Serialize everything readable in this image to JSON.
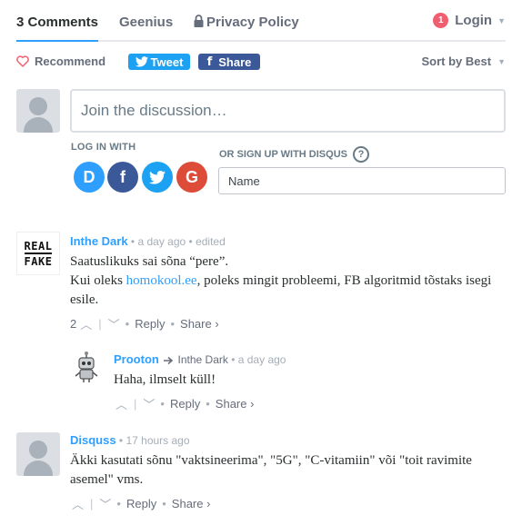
{
  "nav": {
    "comments_tab": "3 Comments",
    "community_tab": "Geenius",
    "privacy_tab": "Privacy Policy",
    "notification_count": "1",
    "login_label": "Login"
  },
  "actions": {
    "recommend_label": "Recommend",
    "tweet_label": "Tweet",
    "share_label": "Share",
    "sort_label": "Sort by Best"
  },
  "compose": {
    "placeholder": "Join the discussion…",
    "login_with": "LOG IN WITH",
    "signup_label": "OR SIGN UP WITH DISQUS",
    "help": "?",
    "name_placeholder": "Name",
    "social": [
      "D",
      "f",
      "t",
      "G"
    ]
  },
  "comments": [
    {
      "author": "Inthe Dark",
      "time": "a day ago",
      "edited": "edited",
      "avatar_lines": [
        "REAL",
        "FAKE"
      ],
      "text_line1": "Saatuslikuks sai sõna “pere”.",
      "text_line2_pre": "Kui oleks ",
      "text_link": "homokool.ee",
      "text_line2_post": ", poleks mingit probleemi, FB algoritmid tõstaks isegi esile.",
      "votes": "2",
      "reply_label": "Reply",
      "share_label": "Share ›"
    },
    {
      "author": "Prooton",
      "reply_to": "Inthe Dark",
      "time": "a day ago",
      "text": "Haha, ilmselt küll!",
      "reply_label": "Reply",
      "share_label": "Share ›"
    },
    {
      "author": "Disquss",
      "time": "17 hours ago",
      "text": "Äkki kasutati sõnu \"vaktsineerima\", \"5G\", \"C-vitamiin\" või \"toit ravimite asemel\" vms.",
      "reply_label": "Reply",
      "share_label": "Share ›"
    }
  ],
  "colors": {
    "accent": "#2e9fff",
    "tweet": "#1da1f2",
    "facebook": "#3b5998",
    "notification": "#f05f70",
    "disqus": "#2e9fff",
    "twitter_social": "#1da1f2",
    "google": "#dd4b39"
  }
}
